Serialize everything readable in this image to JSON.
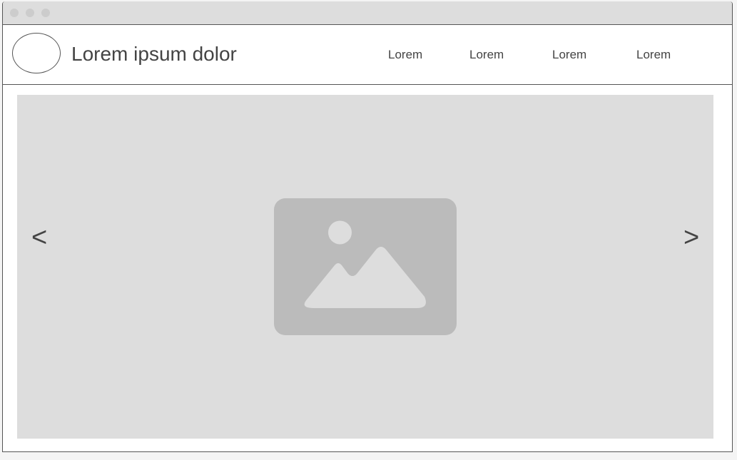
{
  "header": {
    "logo_icon": "circle-logo-placeholder",
    "title": "Lorem ipsum dolor",
    "nav": [
      {
        "label": "Lorem"
      },
      {
        "label": "Lorem"
      },
      {
        "label": "Lorem"
      },
      {
        "label": "Lorem"
      }
    ]
  },
  "carousel": {
    "prev_label": "<",
    "next_label": ">",
    "image_icon": "image-placeholder-icon"
  },
  "colors": {
    "background": "#dddddd",
    "placeholder": "#bbbbbb",
    "text": "#444444",
    "border": "#555555"
  }
}
